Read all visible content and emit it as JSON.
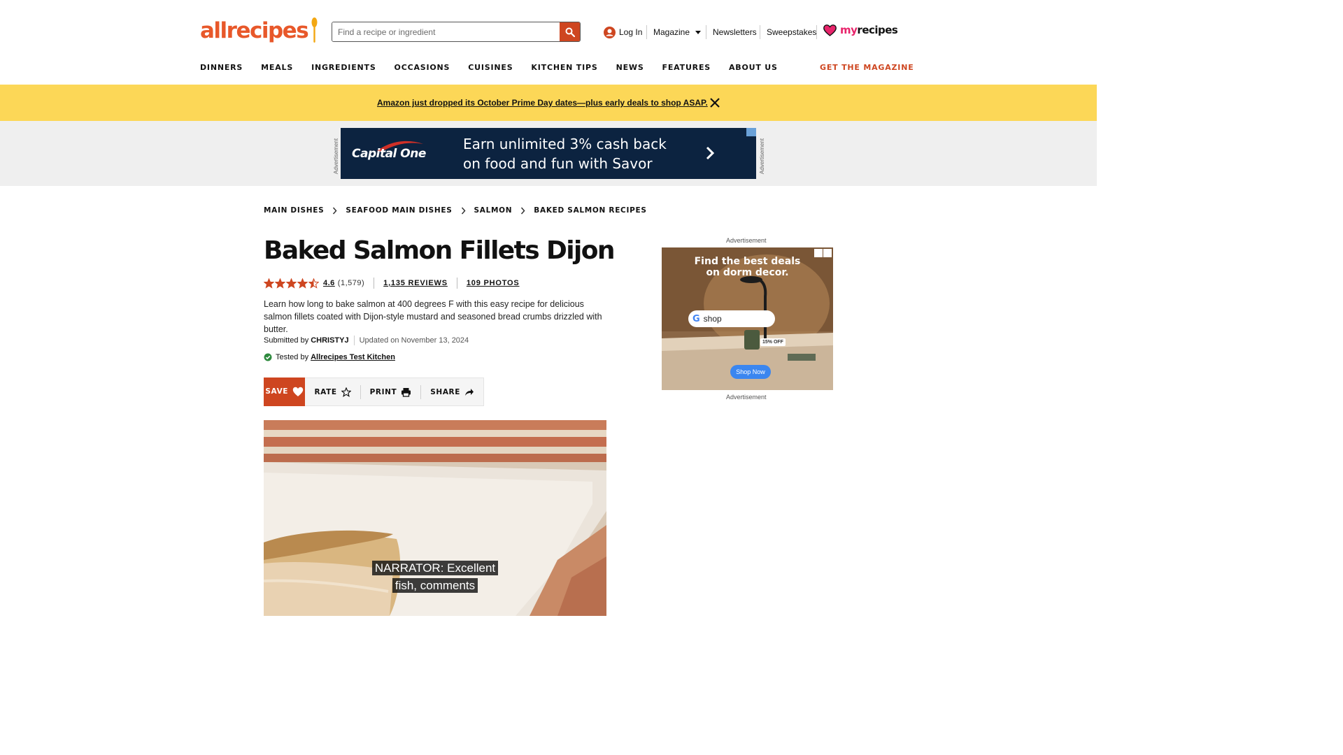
{
  "header": {
    "logo": "allrecipes",
    "search": {
      "placeholder": "Find a recipe or ingredient"
    },
    "login": "Log In",
    "magazine": "Magazine",
    "newsletters": "Newsletters",
    "sweepstakes": "Sweepstakes",
    "myrecipes_my": "my",
    "myrecipes_recipes": "recipes",
    "nav": [
      "DINNERS",
      "MEALS",
      "INGREDIENTS",
      "OCCASIONS",
      "CUISINES",
      "KITCHEN TIPS",
      "NEWS",
      "FEATURES",
      "ABOUT US"
    ],
    "get_magazine": "GET THE MAGAZINE",
    "colors": {
      "brand": "#ce4620",
      "myrecipes_pink": "#e8246b"
    }
  },
  "promo": {
    "text": "Amazon just dropped its October Prime Day dates—plus early deals to shop ASAP.",
    "background": "#fcd757"
  },
  "top_ad": {
    "side_label": "Advertisement",
    "brand": "Capital One",
    "copy_line1": "Earn unlimited 3% cash back",
    "copy_line2": "on food and fun with Savor"
  },
  "breadcrumbs": [
    "MAIN DISHES",
    "SEAFOOD MAIN DISHES",
    "SALMON",
    "BAKED SALMON RECIPES"
  ],
  "recipe": {
    "title": "Baked Salmon Fillets Dijon",
    "rating": "4.6",
    "rating_count": "(1,579)",
    "rating_stars": 4.5,
    "reviews": "1,135 REVIEWS",
    "photos": "109 PHOTOS",
    "description": "Learn how long to bake salmon at 400 degrees F with this easy recipe for delicious salmon fillets coated with Dijon-style mustard and seasoned bread crumbs drizzled with butter.",
    "submitted_by_label": "Submitted by",
    "author": "CHRISTYJ",
    "updated": "Updated on November 13, 2024",
    "tested_by_label": "Tested by",
    "tested_by": "Allrecipes Test Kitchen"
  },
  "actions": {
    "save": "SAVE",
    "rate": "RATE",
    "print": "PRINT",
    "share": "SHARE"
  },
  "video": {
    "caption_line1": "NARRATOR: Excellent",
    "caption_line2": "fish, comments"
  },
  "side_ad": {
    "label_top": "Advertisement",
    "label_bottom": "Advertisement",
    "headline_line1": "Find the best deals",
    "headline_line2": "on dorm decor.",
    "search_text": "shop",
    "discount": "15% OFF",
    "cta": "Shop Now"
  }
}
